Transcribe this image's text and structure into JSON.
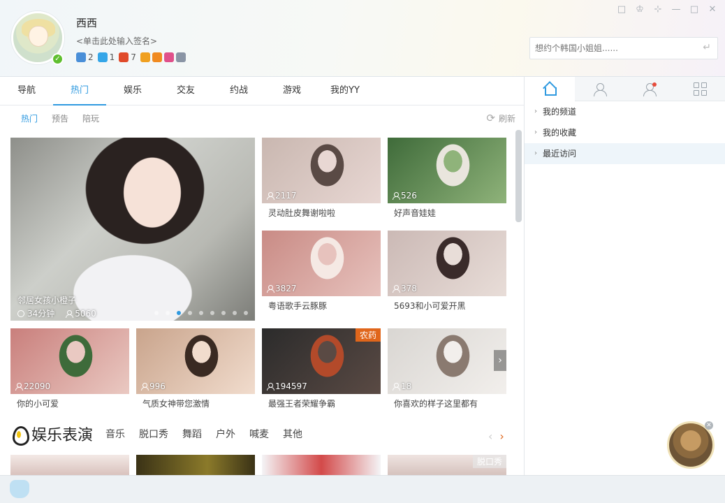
{
  "profile": {
    "username": "西西",
    "signature": "<单击此处输入签名>",
    "badges": [
      {
        "icon": "game-icon",
        "color": "#4a8fd8",
        "count": "2"
      },
      {
        "icon": "diamond-icon",
        "color": "#35a6e8",
        "count": "1"
      },
      {
        "icon": "vip-icon",
        "color": "#e04a2a",
        "count": "7"
      },
      {
        "icon": "play-icon",
        "color": "#f0a020",
        "count": ""
      },
      {
        "icon": "bear-icon",
        "color": "#f08a20",
        "count": ""
      },
      {
        "icon": "heart-icon",
        "color": "#e0508a",
        "count": ""
      },
      {
        "icon": "eye-icon",
        "color": "#8a95a5",
        "count": ""
      }
    ]
  },
  "window_controls": [
    "□",
    "♔",
    "⊹",
    "—",
    "□",
    "✕"
  ],
  "search": {
    "placeholder": "想约个韩国小姐姐......",
    "enter_icon": "↵"
  },
  "main_tabs": [
    "导航",
    "热门",
    "娱乐",
    "交友",
    "约战",
    "游戏",
    "我的YY"
  ],
  "active_main_tab": "热门",
  "sub_tabs": [
    "热门",
    "预告",
    "陪玩"
  ],
  "refresh_label": "刷新",
  "featured": {
    "title": "邻居女孩小橙子",
    "duration": "34分钟",
    "viewers": "5060",
    "dots": 9,
    "active_dot": 3
  },
  "tiles": [
    {
      "title": "灵动肚皮舞谢啦啦",
      "count": "2117",
      "colors": [
        "#c9b7b0",
        "#e8d7d3",
        "#5a4a45"
      ]
    },
    {
      "title": "好声音娃娃",
      "count": "526",
      "colors": [
        "#3f6b3a",
        "#8fb37a",
        "#e9e5dd"
      ]
    },
    {
      "title": "粤语歌手云豚豚",
      "count": "3827",
      "colors": [
        "#c98b85",
        "#e7c2bd",
        "#f5e9e4"
      ]
    },
    {
      "title": "5693和小可爱开黑",
      "count": "378",
      "colors": [
        "#cbb9b5",
        "#e8ddd8",
        "#3a2b2a"
      ]
    },
    {
      "title": "你的小可爱",
      "count": "22090",
      "colors": [
        "#c97f7c",
        "#eac9c2",
        "#3e6b3a"
      ]
    },
    {
      "title": "气质女神带您激情",
      "count": "996",
      "colors": [
        "#c9a48c",
        "#f1dccd",
        "#3a2a22"
      ]
    },
    {
      "title": "最强王者荣耀争霸",
      "count": "194597",
      "colors": [
        "#2b2b2b",
        "#5a4a44",
        "#b34a2a"
      ],
      "tag": "农药"
    },
    {
      "title": "你喜欢的样子这里都有",
      "count": "18",
      "colors": [
        "#d9d6d2",
        "#f2efec",
        "#8a7a70"
      ]
    }
  ],
  "section": {
    "title": "娱乐表演",
    "tabs": [
      "音乐",
      "脱口秀",
      "舞蹈",
      "户外",
      "喊麦",
      "其他"
    ],
    "preview_tag": "脱口秀"
  },
  "right_sidebar": {
    "tabs": [
      "home-icon",
      "user-icon",
      "friends-icon",
      "apps-icon"
    ],
    "items": [
      "我的频道",
      "我的收藏",
      "最近访问"
    ]
  }
}
